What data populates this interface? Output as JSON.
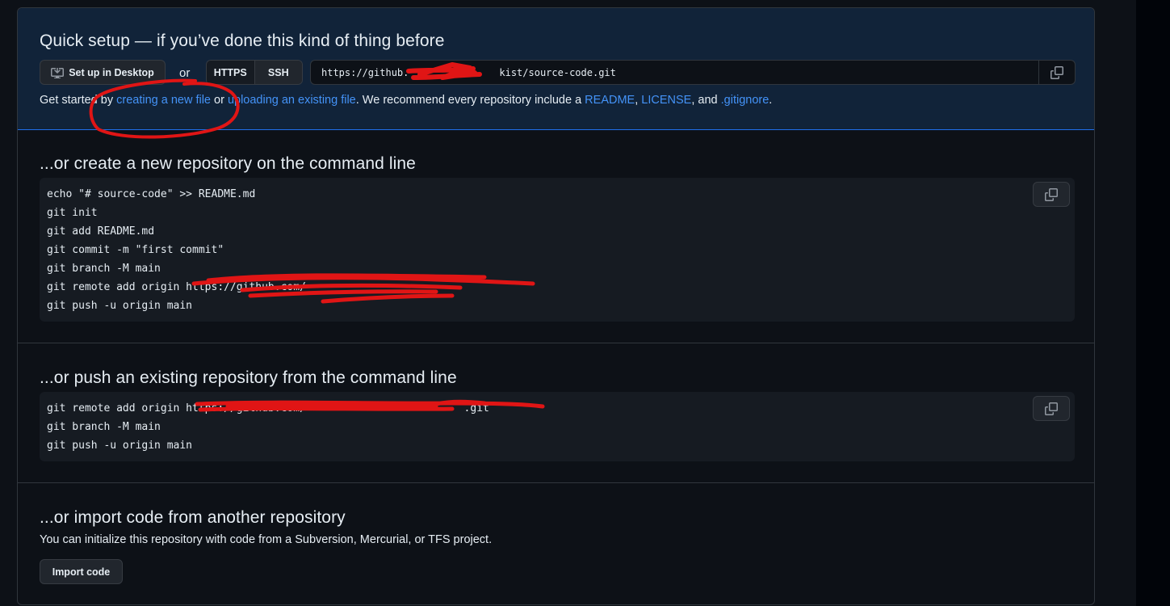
{
  "quick_setup": {
    "title": "Quick setup — if you’ve done this kind of thing before",
    "desktop_button": "Set up in Desktop",
    "or_text": "or",
    "protocols": [
      "HTTPS",
      "SSH"
    ],
    "clone_url": "https://github.",
    "clone_url_tail": "kist/source-code.git",
    "get_started": {
      "prefix": "Get started by ",
      "link_new_file": "creating a new file",
      "mid1": " or ",
      "link_upload": "uploading an existing file",
      "mid2": ". We recommend every repository include a ",
      "link_readme": "README",
      "comma": ", ",
      "link_license": "LICENSE",
      "and_text": ", and ",
      "link_gitignore": ".gitignore",
      "period": "."
    }
  },
  "new_repo": {
    "title": "...or create a new repository on the command line",
    "lines": [
      "echo \"# source-code\" >> README.md",
      "git init",
      "git add README.md",
      "git commit -m \"first commit\"",
      "git branch -M main",
      "git remote add origin https://github.com/",
      "git push -u origin main"
    ]
  },
  "push_existing": {
    "title": "...or push an existing repository from the command line",
    "lines": [
      "git remote add origin https://github.com/                         .git",
      "git branch -M main",
      "git push -u origin main"
    ]
  },
  "import_code": {
    "title": "...or import code from another repository",
    "description": "You can initialize this repository with code from a Subversion, Mercurial, or TFS project.",
    "button": "Import code"
  },
  "colors": {
    "background": "#0d1117",
    "quick_setup_bg": "#112339",
    "link": "#4493f8",
    "annotation_red": "#e01515"
  },
  "icons": {
    "desktop": "desktop-download-icon",
    "copy": "copy-icon"
  }
}
